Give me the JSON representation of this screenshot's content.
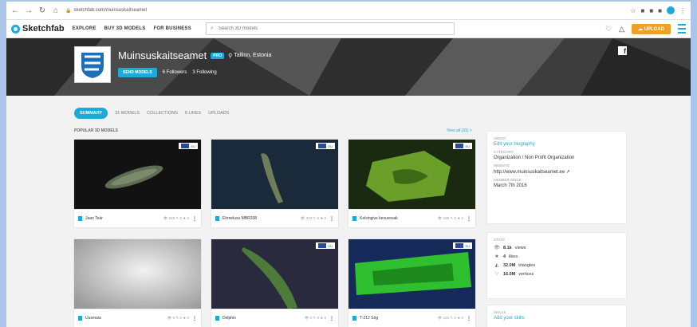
{
  "browser": {
    "url": "sketchfab.com/muinsuskaitseamet",
    "nav_icons": [
      "back-icon",
      "forward-icon",
      "reload-icon",
      "home-icon"
    ]
  },
  "topnav": {
    "brand": "Sketchfab",
    "explore": "EXPLORE",
    "buy": "BUY 3D MODELS",
    "business": "FOR BUSINESS",
    "search_placeholder": "Search 3D models",
    "upload": "UPLOAD"
  },
  "profile": {
    "name": "Muinsuskaitseamet",
    "badge": "PRO",
    "location": "Tallinn, Estonia",
    "follow_label": "SEND MODELS",
    "followers": "6 Followers",
    "following": "3 Following"
  },
  "tabs": [
    {
      "label": "SUMMARY",
      "active": true
    },
    {
      "label": "31 MODELS",
      "active": false
    },
    {
      "label": "COLLECTIONS",
      "active": false
    },
    {
      "label": "8 LIKES",
      "active": false
    },
    {
      "label": "UPLOADS",
      "active": false
    }
  ],
  "section": {
    "title": "POPULAR 3D MODELS",
    "view_all": "View all (31) >"
  },
  "models": [
    {
      "name": "Jaan Teär",
      "stats": "👁 528 ✎ 0 ★ 2"
    },
    {
      "name": "Ehmelusu MBR338",
      "stats": "👁 323 ✎ 0 ★ 0"
    },
    {
      "name": "Kelsingive kesuvesak",
      "stats": "👁 199 ✎ 0 ★ 1"
    },
    {
      "name": "Uusmaia",
      "stats": "👁 0 ✎ 0 ★ 0"
    },
    {
      "name": "Delphin",
      "stats": "👁 0 ✎ 0 ★ 0"
    },
    {
      "name": "T-212 Sög",
      "stats": "👁 122 ✎ 0 ★ 0"
    }
  ],
  "about": {
    "heading": "ABOUT",
    "bio_link": "Edit your biography",
    "category_label": "CATEGORY",
    "category": "Organization / Non Profit Organization",
    "website_label": "WEBSITE",
    "website": "http://www.muinsuskaitseamet.ee",
    "member_label": "MEMBER SINCE",
    "member_since": "March 7th 2016"
  },
  "stats": {
    "heading": "STATS",
    "rows": [
      {
        "value": "8.1k",
        "label": "views"
      },
      {
        "value": "4",
        "label": "likes"
      },
      {
        "value": "32.0M",
        "label": "triangles"
      },
      {
        "value": "16.0M",
        "label": "vertices"
      }
    ]
  },
  "skills": {
    "heading": "SKILLS",
    "link": "Add your skills"
  },
  "colors": {
    "accent": "#1caad9",
    "upload": "#f0a028"
  }
}
